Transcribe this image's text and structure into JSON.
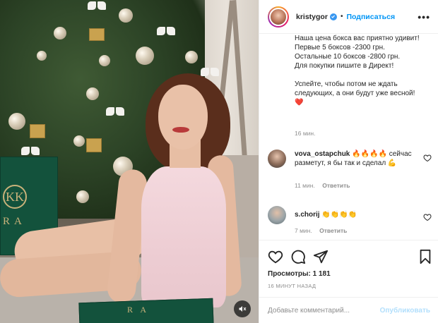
{
  "header": {
    "username": "kristygor",
    "separator": "•",
    "follow_label": "Подписаться",
    "more_label": "•••"
  },
  "caption": {
    "lines": [
      "Наша цена бокса вас приятно удивит!",
      "Первые 5 боксов -2300 грн.",
      "Остальные 10 боксов -2800 грн.",
      "Для покупки пишите в Директ!",
      "",
      "Успейте, чтобы потом не ждать следующих, а они будут уже весной!",
      "❤️"
    ],
    "time": "16 мин."
  },
  "comments": [
    {
      "username": "vova_ostapchuk",
      "text": "🔥🔥🔥🔥 сейчас разметут, я бы так и сделал 💪",
      "time": "11 мин.",
      "reply_label": "Ответить"
    },
    {
      "username": "s.chorij",
      "text": "👏👏👏👏",
      "time": "7 мин.",
      "reply_label": "Ответить"
    }
  ],
  "stats": {
    "views_label": "Просмотры:",
    "views_count": "1 181",
    "posted_ago": "16 МИНУТ НАЗАД"
  },
  "composer": {
    "placeholder": "Добавьте комментарий...",
    "publish_label": "Опубликовать"
  },
  "media": {
    "box_logo": "KK",
    "box_text": "RA",
    "box_bottom_text": "R A"
  },
  "colors": {
    "accent": "#0095f6",
    "publish_disabled": "#b2dffc",
    "verified": "#3897f0"
  },
  "icons": [
    "heart-icon",
    "comment-icon",
    "share-icon",
    "bookmark-icon",
    "mute-icon",
    "verified-icon"
  ]
}
